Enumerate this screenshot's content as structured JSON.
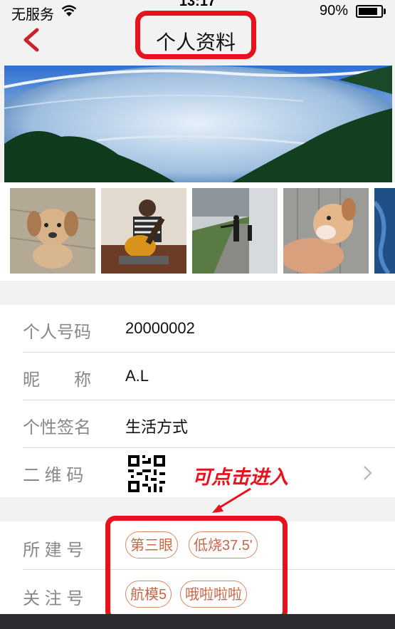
{
  "status_bar": {
    "carrier": "无服务",
    "time": "13:17",
    "battery_percent": "90%",
    "battery_level": 0.9
  },
  "nav": {
    "title": "个人资料"
  },
  "profile": {
    "rows": [
      {
        "label": "个人号码",
        "value": "20000002"
      },
      {
        "label": "昵　　称",
        "value": "A.L"
      },
      {
        "label": "个性签名",
        "value": "生活方式"
      },
      {
        "label": "二 维 码",
        "value": ""
      }
    ],
    "groups": [
      {
        "label": "所 建 号",
        "tags": [
          "第三眼",
          "低烧37.5'"
        ]
      },
      {
        "label": "关 注 号",
        "tags": [
          "航模5",
          "哦啦啦啦"
        ]
      }
    ]
  },
  "annotation": {
    "text": "可点击进入"
  },
  "colors": {
    "accent_red": "#c8232c",
    "annotation_red": "#e8121c",
    "tag_border": "#d9876c",
    "tag_text": "#c6674a"
  },
  "icons": [
    "back-chevron-icon",
    "wifi-icon",
    "battery-icon",
    "qr-code-icon",
    "chevron-right-icon"
  ]
}
